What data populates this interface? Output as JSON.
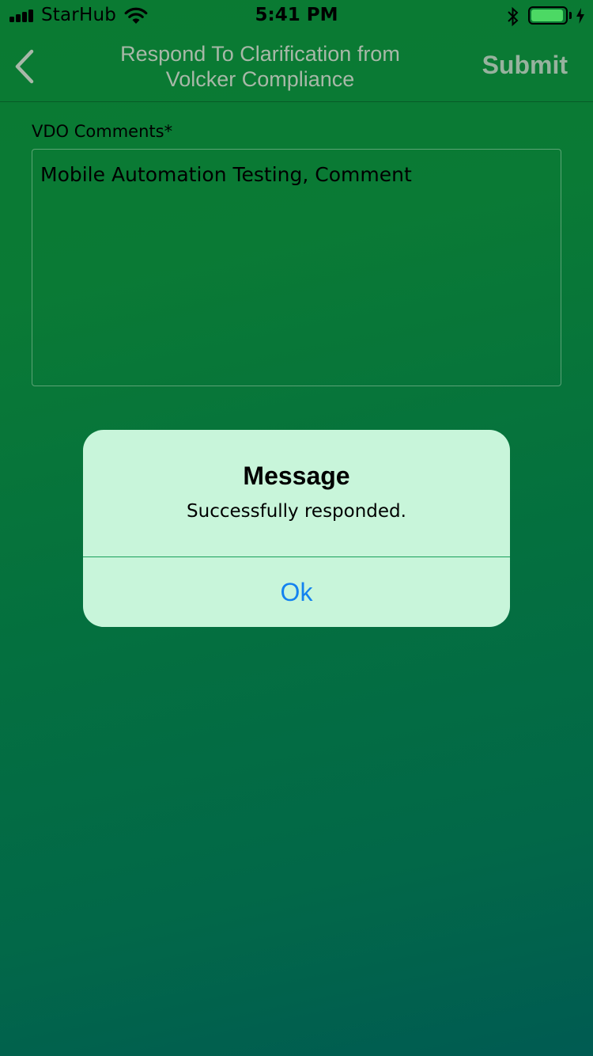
{
  "status_bar": {
    "carrier": "StarHub",
    "time": "5:41 PM",
    "battery_level": 0.95,
    "icons": [
      "signal-icon",
      "wifi-icon",
      "bluetooth-icon",
      "battery-icon",
      "charging-icon"
    ]
  },
  "nav": {
    "back_icon": "chevron-left-icon",
    "title": "Respond To Clarification from Volcker Compliance",
    "submit_label": "Submit"
  },
  "form": {
    "comments_label": "VDO Comments*",
    "comments_value": "Mobile Automation Testing, Comment"
  },
  "alert": {
    "title": "Message",
    "message": "Successfully responded.",
    "ok_label": "Ok"
  },
  "colors": {
    "background_top": "#0a7a32",
    "background_bottom": "#005b52",
    "alert_background": "#c8f5da",
    "alert_button": "#1382f0",
    "nav_title": "#a8b8a8",
    "submit": "#97b29e"
  }
}
